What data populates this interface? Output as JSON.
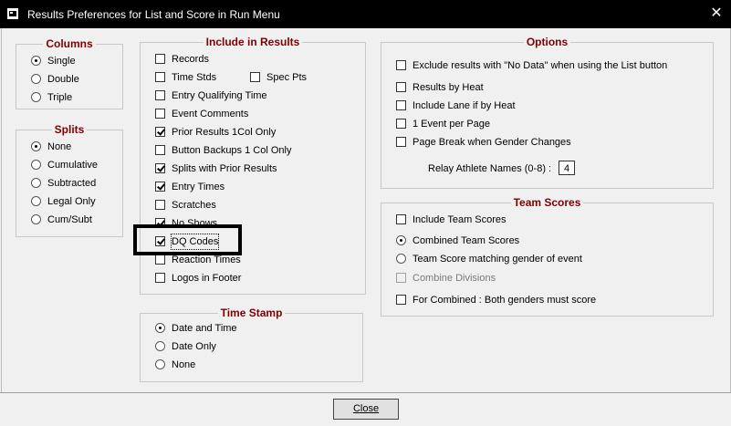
{
  "window": {
    "title": "Results Preferences for List and Score in Run Menu",
    "close_glyph": "✕"
  },
  "columns": {
    "title": "Columns",
    "options": [
      "Single",
      "Double",
      "Triple"
    ],
    "selected": "Single"
  },
  "splits": {
    "title": "Splits",
    "options": [
      "None",
      "Cumulative",
      "Subtracted",
      "Legal Only",
      "Cum/Subt"
    ],
    "selected": "None"
  },
  "include": {
    "title": "Include in Results",
    "records": "Records",
    "time_stds": "Time Stds",
    "spec_pts": "Spec Pts",
    "entry_qualifying_time": "Entry Qualifying Time",
    "event_comments": "Event Comments",
    "prior_results_1col": "Prior Results 1Col Only",
    "button_backups": "Button Backups 1 Col Only",
    "splits_with_prior": "Splits with Prior Results",
    "entry_times": "Entry Times",
    "scratches": "Scratches",
    "no_shows": "No Shows",
    "dq_codes": "DQ Codes",
    "reaction_times": "Reaction Times",
    "logos_in_footer": "Logos in Footer"
  },
  "timestamp": {
    "title": "Time Stamp",
    "options": [
      "Date and Time",
      "Date Only",
      "None"
    ],
    "selected": "Date and Time"
  },
  "options": {
    "title": "Options",
    "exclude_no_data": "Exclude results with \"No Data\" when using the List button",
    "results_by_heat": "Results by Heat",
    "include_lane": "Include Lane if by Heat",
    "one_event_per_page": "1 Event per Page",
    "page_break_gender": "Page Break when Gender Changes",
    "relay_names_label": "Relay Athlete Names (0-8) :",
    "relay_names_value": "4"
  },
  "team_scores": {
    "title": "Team Scores",
    "include_team_scores": "Include Team Scores",
    "combined": "Combined Team Scores",
    "matching_gender": "Team Score matching gender of event",
    "combine_divisions": "Combine Divisions",
    "both_genders": "For Combined : Both genders must score"
  },
  "footer": {
    "close_label": "Close"
  }
}
